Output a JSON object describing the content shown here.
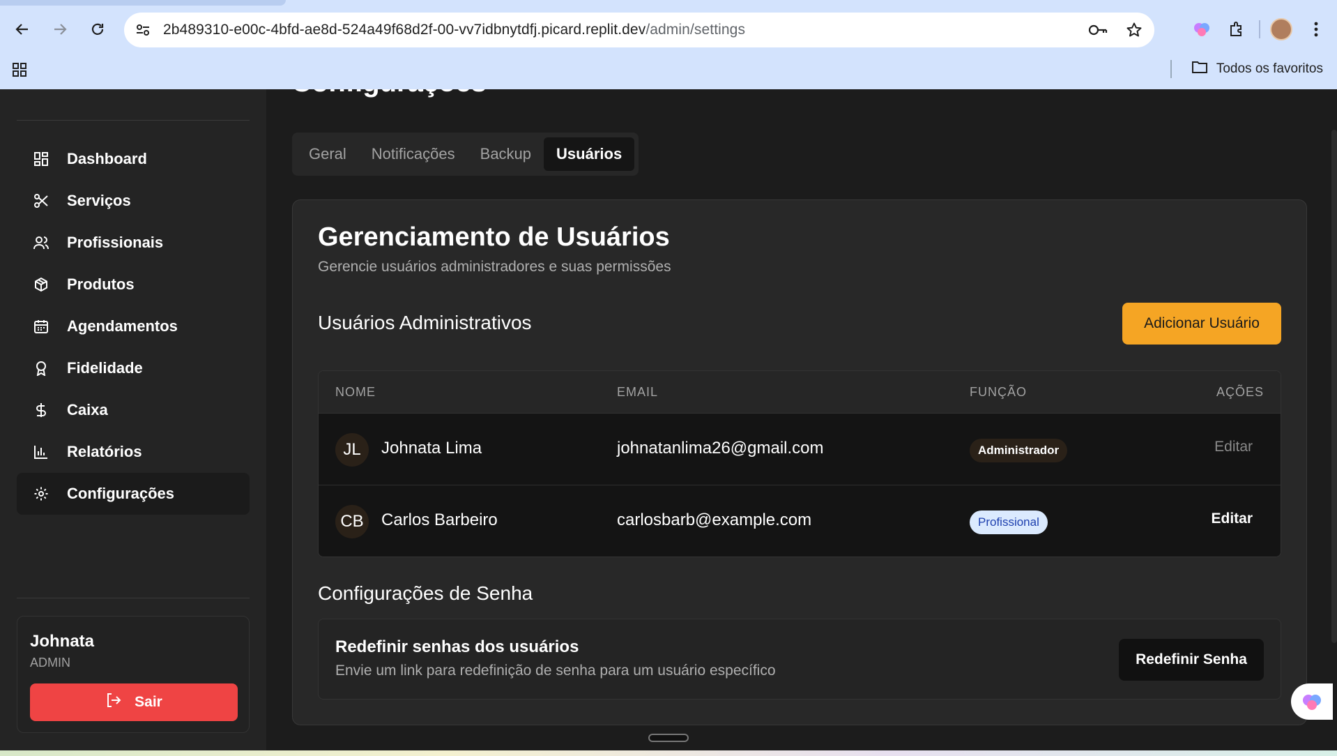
{
  "browser": {
    "url_host": "2b489310-e00c-4bfd-ae8d-524a49f68d2f-00-vv7idbnytdfj.picard.replit.dev",
    "url_path": "/admin/settings",
    "bookmarks_label": "Todos os favoritos"
  },
  "sidebar": {
    "items": [
      {
        "label": "Dashboard",
        "icon": "dashboard-icon"
      },
      {
        "label": "Serviços",
        "icon": "scissors-icon"
      },
      {
        "label": "Profissionais",
        "icon": "users-icon"
      },
      {
        "label": "Produtos",
        "icon": "package-icon"
      },
      {
        "label": "Agendamentos",
        "icon": "calendar-icon"
      },
      {
        "label": "Fidelidade",
        "icon": "award-icon"
      },
      {
        "label": "Caixa",
        "icon": "dollar-icon"
      },
      {
        "label": "Relatórios",
        "icon": "bar-chart-icon"
      },
      {
        "label": "Configurações",
        "icon": "gear-icon",
        "active": true
      }
    ],
    "user": {
      "name": "Johnata",
      "role": "ADMIN",
      "logout_label": "Sair"
    }
  },
  "page": {
    "title": "Configurações",
    "tabs": [
      "Geral",
      "Notificações",
      "Backup",
      "Usuários"
    ],
    "active_tab": "Usuários"
  },
  "users_card": {
    "title": "Gerenciamento de Usuários",
    "subtitle": "Gerencie usuários administradores e suas permissões",
    "section_admins": "Usuários Administrativos",
    "add_button": "Adicionar Usuário",
    "columns": [
      "NOME",
      "EMAIL",
      "FUNÇÃO",
      "AÇÕES"
    ],
    "rows": [
      {
        "initials": "JL",
        "name": "Johnata Lima",
        "email": "johnatanlima26@gmail.com",
        "role": "Administrador",
        "action": "Editar",
        "action_enabled": false
      },
      {
        "initials": "CB",
        "name": "Carlos Barbeiro",
        "email": "carlosbarb@example.com",
        "role": "Profissional",
        "action": "Editar",
        "action_enabled": true
      }
    ],
    "section_password": "Configurações de Senha",
    "password_title": "Redefinir senhas dos usuários",
    "password_desc": "Envie um link para redefinição de senha para um usuário específico",
    "password_button": "Redefinir Senha"
  },
  "colors": {
    "accent": "#f5a524",
    "danger": "#ef4444",
    "badge_pro_bg": "#dbeafe",
    "badge_pro_text": "#1e40af"
  }
}
